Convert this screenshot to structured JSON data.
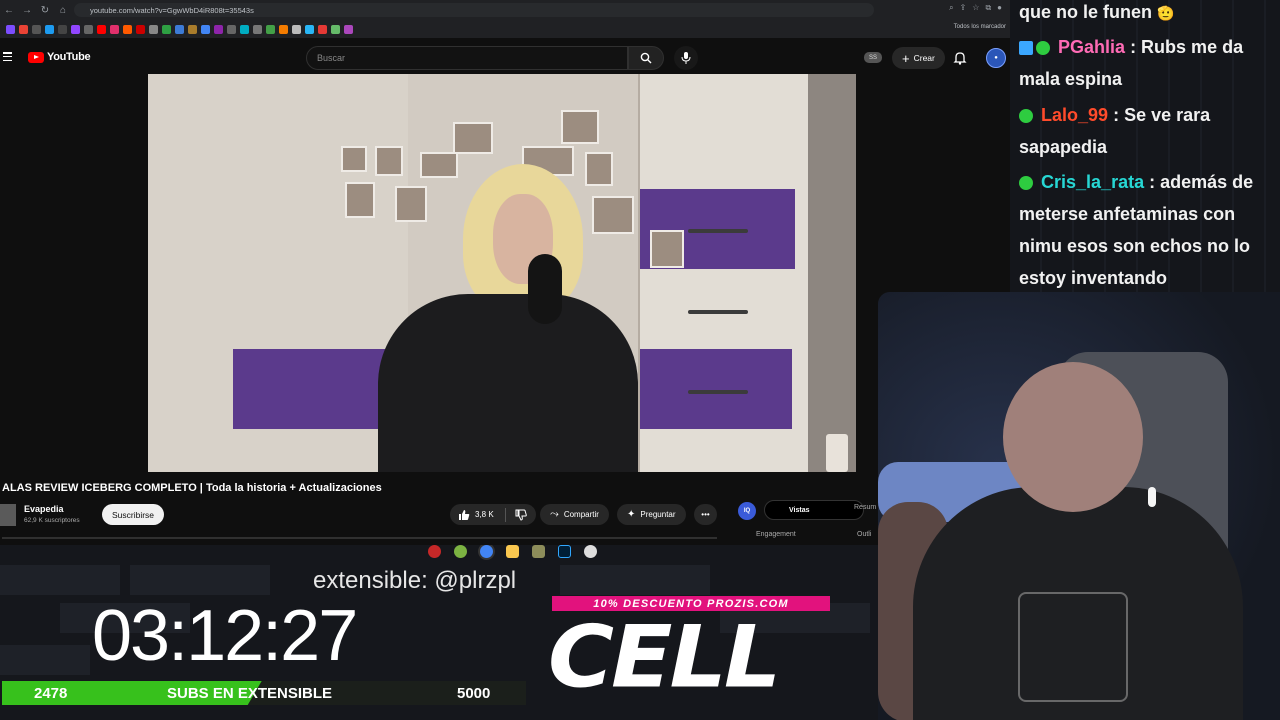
{
  "browser": {
    "url": "youtube.com/watch?v=GgwWbD4iR808t=35543s",
    "bookmarks_label": "Todos los marcador"
  },
  "youtube": {
    "logo_text": "YouTube",
    "search_placeholder": "Buscar",
    "ss_badge": "SS",
    "create_label": "Crear",
    "video_title": "ALAS REVIEW ICEBERG COMPLETO | Toda la historia + Actualizaciones",
    "channel_name": "Evapedia",
    "subscriber_count": "62,9 K suscriptores",
    "subscribe_label": "Suscribirse",
    "likes": "3,8 K",
    "share_label": "Compartir",
    "ask_label": "Preguntar",
    "side_panel": {
      "iq": "IQ",
      "tab_views": "Vistas",
      "tab_summary": "Resum",
      "engagement": "Engagement",
      "outline": "Outli"
    }
  },
  "overlay": {
    "scroll_text": "extensible: @plrzpl",
    "timer": "03:12:27",
    "subs_current": "2478",
    "subs_label": "SUBS EN EXTENSIBLE",
    "subs_goal": "5000",
    "subs_progress": 0.4956,
    "promo": "10% DESCUENTO PROZIS.COM",
    "sponsor": "CELL"
  },
  "chat": {
    "messages": [
      {
        "user": "",
        "text": "que no le funen"
      },
      {
        "user": "PGahlia",
        "text": ": Rubs me da mala espina"
      },
      {
        "user": "Lalo_99",
        "text": ": Se ve rara sapapedia"
      },
      {
        "user": "Cris_la_rata",
        "text": ": además de meterse anfetaminas con nimu esos son echos no lo estoy inventando"
      }
    ]
  },
  "colors": {
    "accent_green": "#37c11c",
    "promo_pink": "#e2127d",
    "yt_red": "#ff0000"
  }
}
